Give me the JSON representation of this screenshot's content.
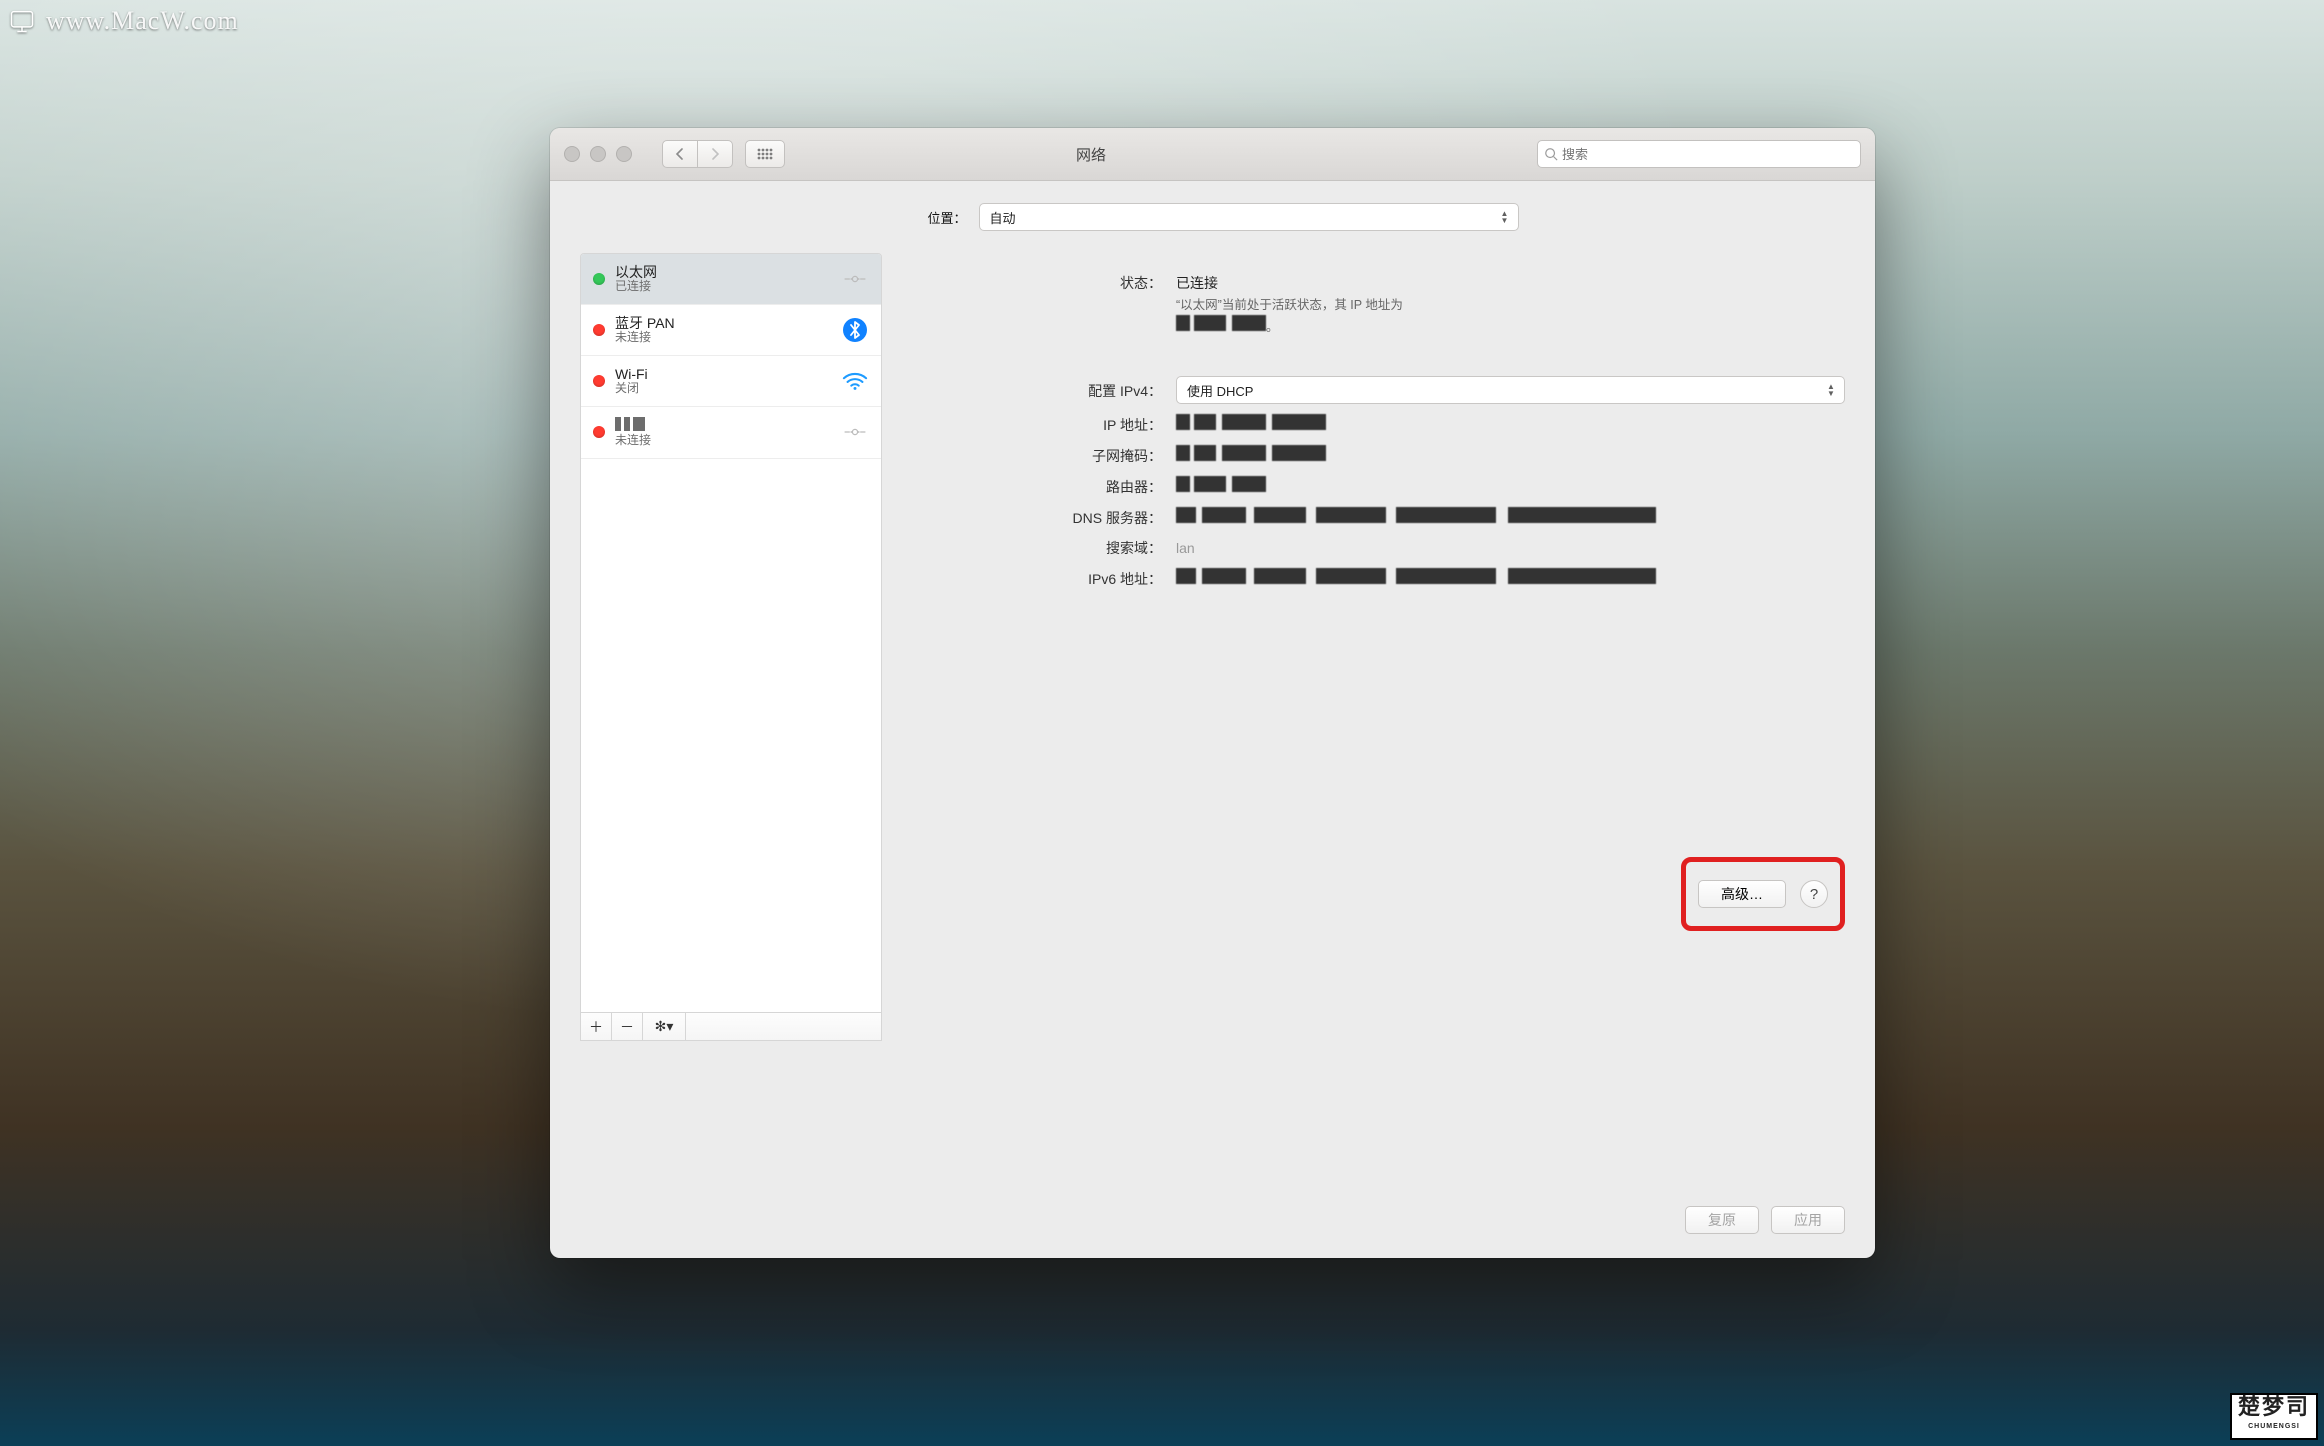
{
  "watermark_top": "www.MacW.com",
  "watermark_bottom_main": "楚梦司",
  "watermark_bottom_sub": "CHUMENGSI",
  "window": {
    "title": "网络",
    "search_placeholder": "搜索"
  },
  "location": {
    "label": "位置：",
    "value": "自动"
  },
  "services": [
    {
      "name": "以太网",
      "status_text": "已连接",
      "dot": "green",
      "icon": "ethernet",
      "selected": true
    },
    {
      "name": "蓝牙 PAN",
      "status_text": "未连接",
      "dot": "red",
      "icon": "bluetooth",
      "selected": false
    },
    {
      "name": "Wi-Fi",
      "status_text": "关闭",
      "dot": "red",
      "icon": "wifi",
      "selected": false
    },
    {
      "name": "██████",
      "status_text": "未连接",
      "dot": "red",
      "icon": "ethernet",
      "selected": false,
      "redacted_name": true
    }
  ],
  "detail": {
    "status_label": "状态：",
    "status_value": "已连接",
    "status_sub_prefix": "“以太网”当前处于活跃状态，其 IP 地址为",
    "config_label": "配置 IPv4：",
    "config_value": "使用 DHCP",
    "ip_label": "IP 地址：",
    "subnet_label": "子网掩码：",
    "router_label": "路由器：",
    "dns_label": "DNS 服务器：",
    "search_domain_label": "搜索域：",
    "search_domain_value": "lan",
    "ipv6_label": "IPv6 地址："
  },
  "buttons": {
    "advanced": "高级…",
    "help": "?",
    "revert": "复原",
    "apply": "应用"
  }
}
